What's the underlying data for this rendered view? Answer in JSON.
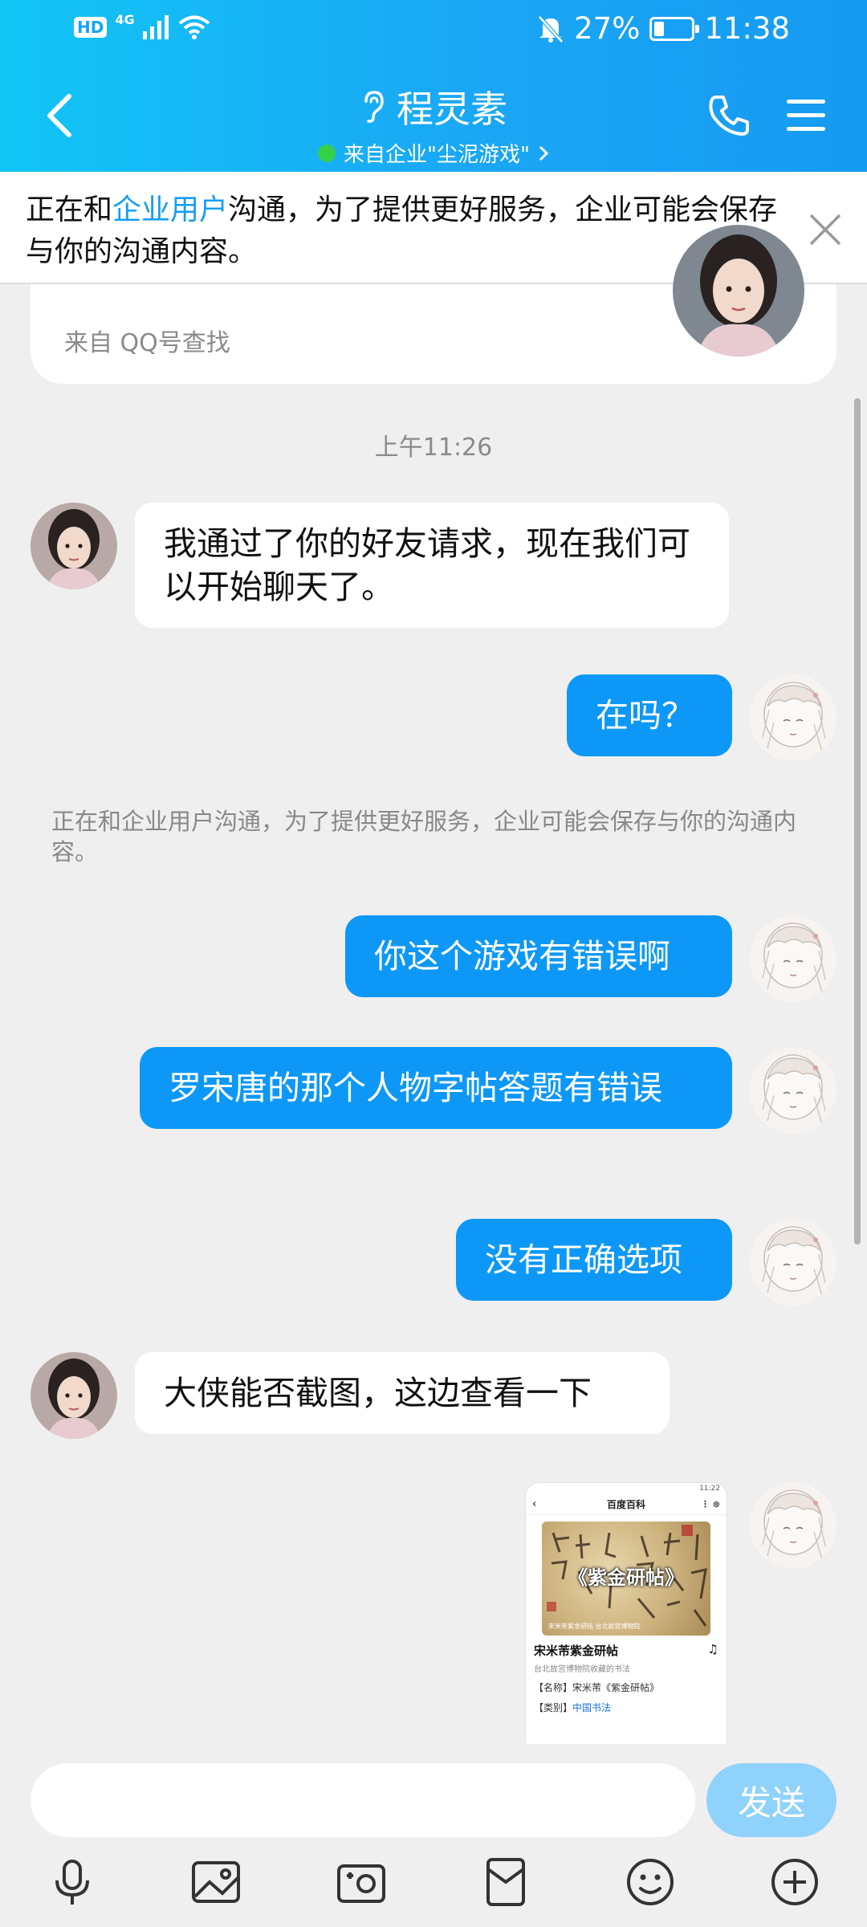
{
  "status_bar": {
    "hd": "HD",
    "network": "4G",
    "battery_percent": "27%",
    "battery_level": 0.27,
    "time": "11:38",
    "icons": [
      "hd-icon",
      "signal-icon",
      "wifi-icon",
      "mute-bell-icon",
      "battery-icon"
    ]
  },
  "header": {
    "title": "程灵素",
    "subtitle": "来自企业\"尘泥游戏\"",
    "icons": [
      "back-arrow-icon",
      "ear-icon",
      "phone-icon",
      "menu-icon",
      "chevron-right-icon"
    ]
  },
  "notice": {
    "text_before": "正在和",
    "link_text": "企业用户",
    "text_after": "沟通，为了提供更好服务，企业可能会保存与你的沟通内容。"
  },
  "profile_card": {
    "source": "来自 QQ号查找"
  },
  "chat": {
    "timestamp": "上午11:26",
    "messages": [
      {
        "from": "them",
        "text": "我通过了你的好友请求，现在我们可以开始聊天了。"
      },
      {
        "from": "me",
        "text": "在吗？"
      },
      {
        "from": "me",
        "text": "你这个游戏有错误啊"
      },
      {
        "from": "me",
        "text": "罗宋唐的那个人物字帖答题有错误"
      },
      {
        "from": "me",
        "text": "没有正确选项"
      },
      {
        "from": "them",
        "text": "大侠能否截图，这边查看一下"
      }
    ],
    "system_note": "正在和企业用户沟通，为了提供更好服务，企业可能会保存与你的沟通内容。",
    "screenshot": {
      "status_time": "11:22",
      "nav_title": "百度百科",
      "image_caption": "《紫金研帖》",
      "image_footer": "宋米芾紫金研帖 台北故宫博物院",
      "title": "宋米芾紫金研帖",
      "subtitle": "台北故宫博物院收藏的书法",
      "line1_label": "【名称】",
      "line1_value": "宋米芾《紫金研帖》",
      "line2_label": "【类别】",
      "line2_value": "中国书法"
    }
  },
  "input": {
    "placeholder": "",
    "send_label": "发送"
  },
  "toolbar": {
    "icons": [
      "microphone-icon",
      "image-icon",
      "camera-icon",
      "red-packet-icon",
      "emoji-icon",
      "plus-icon"
    ]
  },
  "colors": {
    "header_start": "#12c5f5",
    "header_end": "#169af2",
    "bubble_out": "#0d98f7",
    "link": "#159ef0",
    "send_button": "#8fd2fb",
    "online_dot": "#35d04a"
  }
}
